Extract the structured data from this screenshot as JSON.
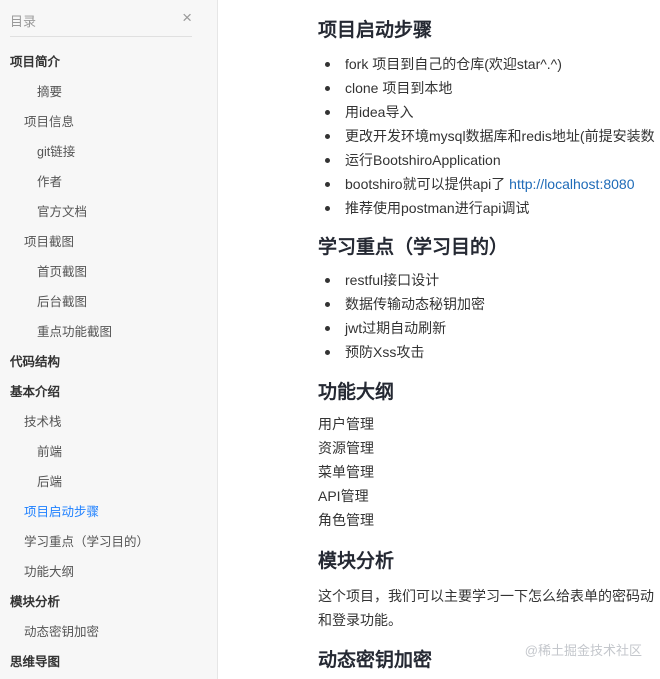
{
  "toc": {
    "title": "目录",
    "close_glyph": "×",
    "items": [
      {
        "label": "项目简介",
        "level": 1
      },
      {
        "label": "摘要",
        "level": 3
      },
      {
        "label": "项目信息",
        "level": 2
      },
      {
        "label": "git链接",
        "level": 3
      },
      {
        "label": "作者",
        "level": 3
      },
      {
        "label": "官方文档",
        "level": 3
      },
      {
        "label": "项目截图",
        "level": 2
      },
      {
        "label": "首页截图",
        "level": 3
      },
      {
        "label": "后台截图",
        "level": 3
      },
      {
        "label": "重点功能截图",
        "level": 3
      },
      {
        "label": "代码结构",
        "level": 1
      },
      {
        "label": "基本介绍",
        "level": 1
      },
      {
        "label": "技术栈",
        "level": 2
      },
      {
        "label": "前端",
        "level": 3
      },
      {
        "label": "后端",
        "level": 3
      },
      {
        "label": "项目启动步骤",
        "level": 2,
        "active": true
      },
      {
        "label": "学习重点（学习目的）",
        "level": 2
      },
      {
        "label": "功能大纲",
        "level": 2
      },
      {
        "label": "模块分析",
        "level": 1
      },
      {
        "label": "动态密钥加密",
        "level": 2
      },
      {
        "label": "思维导图",
        "level": 1
      }
    ]
  },
  "article": {
    "sec_start": {
      "heading": "项目启动步骤",
      "items": [
        "fork 项目到自己的仓库(欢迎star^.^)",
        "clone 项目到本地",
        "用idea导入",
        "更改开发环境mysql数据库和redis地址(前提安装数",
        "运行BootshiroApplication",
        "推荐使用postman进行api调试"
      ],
      "api_prefix": "bootshiro就可以提供api了 ",
      "api_link": "http://localhost:8080"
    },
    "sec_learn": {
      "heading": "学习重点（学习目的）",
      "items": [
        "restful接口设计",
        "数据传输动态秘钥加密",
        "jwt过期自动刷新",
        "预防Xss攻击"
      ]
    },
    "sec_outline": {
      "heading": "功能大纲",
      "items": [
        "用户管理",
        "资源管理",
        "菜单管理",
        "API管理",
        "角色管理"
      ]
    },
    "sec_module": {
      "heading": "模块分析",
      "para_line1": "这个项目，我们可以主要学习一下怎么给表单的密码动",
      "para_line2": "和登录功能。"
    },
    "sec_dynkey": {
      "heading": "动态密钥加密"
    }
  },
  "watermark": "@稀土掘金技术社区"
}
